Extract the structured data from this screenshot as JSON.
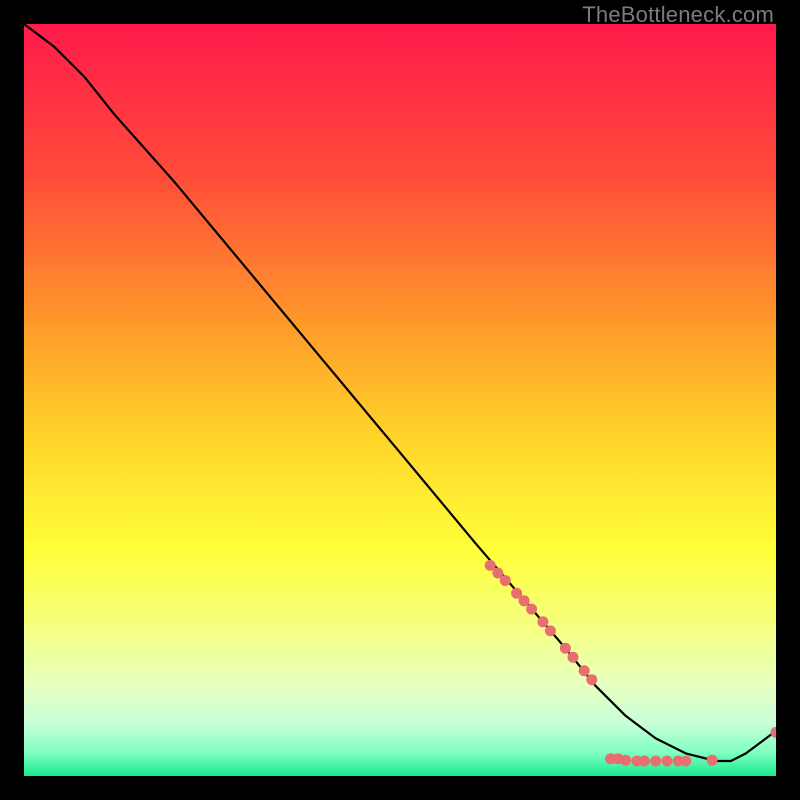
{
  "watermark": "TheBottleneck.com",
  "chart_data": {
    "type": "line",
    "title": "",
    "xlabel": "",
    "ylabel": "",
    "xlim": [
      0,
      100
    ],
    "ylim": [
      0,
      100
    ],
    "background_gradient": {
      "stops": [
        {
          "offset": 0,
          "color": "#ff1a4b"
        },
        {
          "offset": 20,
          "color": "#ff4b3a"
        },
        {
          "offset": 40,
          "color": "#ff9a2a"
        },
        {
          "offset": 55,
          "color": "#ffd42a"
        },
        {
          "offset": 70,
          "color": "#ffff3a"
        },
        {
          "offset": 80,
          "color": "#f6ff80"
        },
        {
          "offset": 88,
          "color": "#e6ffc0"
        },
        {
          "offset": 93,
          "color": "#c8ffd8"
        },
        {
          "offset": 97,
          "color": "#7dffc0"
        },
        {
          "offset": 100,
          "color": "#18e890"
        }
      ]
    },
    "series": [
      {
        "name": "bottleneck-curve",
        "x": [
          0,
          4,
          8,
          12,
          20,
          30,
          40,
          50,
          60,
          66,
          72,
          76,
          80,
          84,
          88,
          92,
          94,
          96,
          100
        ],
        "y": [
          100,
          97,
          93,
          88,
          79,
          67,
          55,
          43,
          31,
          24,
          17,
          12,
          8,
          5,
          3,
          2,
          2,
          3,
          6
        ]
      }
    ],
    "markers": {
      "name": "highlight-dots",
      "color": "#e76f6f",
      "radius": 5.5,
      "points": [
        {
          "x": 62,
          "y": 28
        },
        {
          "x": 63,
          "y": 27
        },
        {
          "x": 64,
          "y": 26
        },
        {
          "x": 65.5,
          "y": 24.3
        },
        {
          "x": 66.5,
          "y": 23.3
        },
        {
          "x": 67.5,
          "y": 22.2
        },
        {
          "x": 69,
          "y": 20.5
        },
        {
          "x": 70,
          "y": 19.3
        },
        {
          "x": 72,
          "y": 17
        },
        {
          "x": 73,
          "y": 15.8
        },
        {
          "x": 74.5,
          "y": 14
        },
        {
          "x": 75.5,
          "y": 12.8
        },
        {
          "x": 78,
          "y": 2.3
        },
        {
          "x": 79,
          "y": 2.3
        },
        {
          "x": 80,
          "y": 2.1
        },
        {
          "x": 81.5,
          "y": 2.0
        },
        {
          "x": 82.5,
          "y": 2.0
        },
        {
          "x": 84,
          "y": 2.0
        },
        {
          "x": 85.5,
          "y": 2.0
        },
        {
          "x": 87,
          "y": 2.0
        },
        {
          "x": 88,
          "y": 2.0
        },
        {
          "x": 91.5,
          "y": 2.1
        },
        {
          "x": 100,
          "y": 5.8
        }
      ]
    }
  }
}
